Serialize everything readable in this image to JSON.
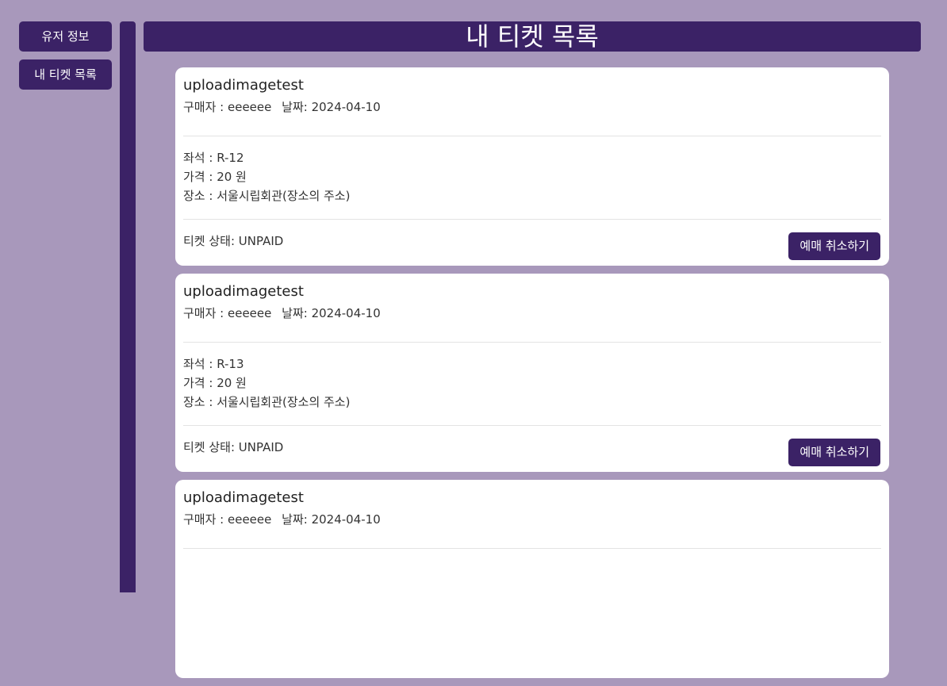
{
  "sidebar": {
    "items": [
      {
        "label": "유저 정보"
      },
      {
        "label": "내 티켓 목록"
      }
    ]
  },
  "header": {
    "title": "내 티켓 목록"
  },
  "tickets": [
    {
      "name": "uploadimagetest",
      "buyer": "구매자 : eeeeee",
      "date": "날짜: 2024-04-10",
      "seat": "좌석 : R-12",
      "price": "가격 : 20 원",
      "venue": "장소 : 서울시립회관(장소의 주소)",
      "status": "티켓 상태: UNPAID",
      "cancel_label": "예매 취소하기"
    },
    {
      "name": "uploadimagetest",
      "buyer": "구매자 : eeeeee",
      "date": "날짜: 2024-04-10",
      "seat": "좌석 : R-13",
      "price": "가격 : 20 원",
      "venue": "장소 : 서울시립회관(장소의 주소)",
      "status": "티켓 상태: UNPAID",
      "cancel_label": "예매 취소하기"
    },
    {
      "name": "uploadimagetest",
      "buyer": "구매자 : eeeeee",
      "date": "날짜: 2024-04-10",
      "seat": "",
      "price": "",
      "venue": "",
      "status": "",
      "cancel_label": ""
    }
  ],
  "colors": {
    "background": "#a898bb",
    "accent": "#3b2266",
    "card": "#ffffff"
  }
}
